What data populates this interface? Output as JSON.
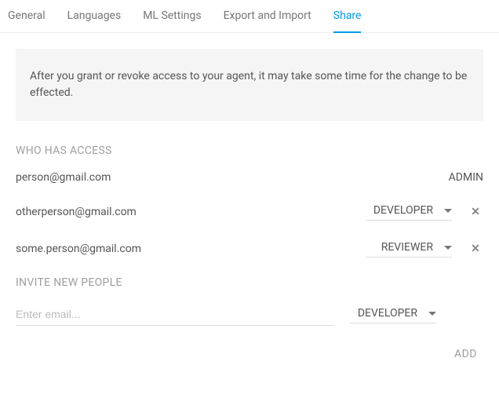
{
  "tabs": {
    "general": "General",
    "languages": "Languages",
    "ml_settings": "ML Settings",
    "export_import": "Export and Import",
    "share": "Share"
  },
  "info_message": "After you grant or revoke access to your agent, it may take some time for the change to be effected.",
  "sections": {
    "who_has_access": "WHO HAS ACCESS",
    "invite": "INVITE NEW PEOPLE"
  },
  "access": {
    "owner": {
      "email": "person@gmail.com",
      "role": "ADMIN"
    },
    "user1": {
      "email": "otherperson@gmail.com",
      "role": "DEVELOPER"
    },
    "user2": {
      "email": "some.person@gmail.com",
      "role": "REVIEWER"
    }
  },
  "invite": {
    "placeholder": "Enter email...",
    "default_role": "DEVELOPER",
    "add_label": "ADD"
  }
}
